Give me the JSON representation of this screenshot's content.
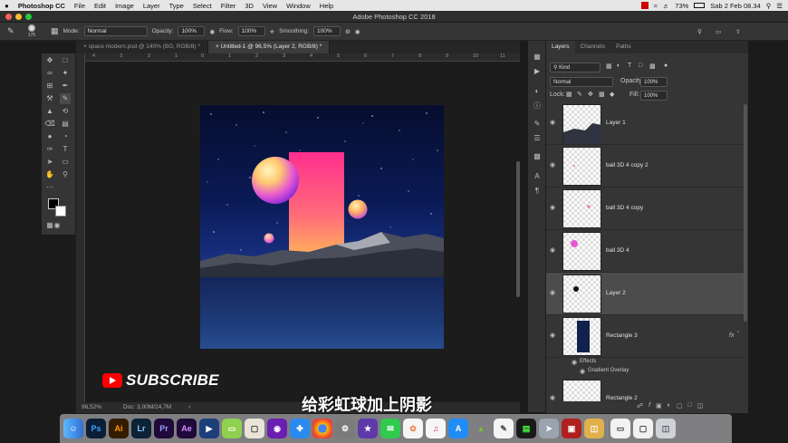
{
  "menubar": {
    "apple": "",
    "app": "Photoshop CC",
    "items": [
      "File",
      "Edit",
      "Image",
      "Layer",
      "Type",
      "Select",
      "Filter",
      "3D",
      "View",
      "Window",
      "Help"
    ],
    "battery": "73%",
    "clock": "Sab 2 Feb 08.34"
  },
  "window": {
    "title": "Adobe Photoshop CC 2018"
  },
  "options": {
    "brush_size": "175",
    "mode_label": "Mode:",
    "mode_value": "Normal",
    "opacity_label": "Opacity:",
    "opacity_value": "100%",
    "flow_label": "Flow:",
    "flow_value": "100%",
    "smoothing_label": "Smoothing:",
    "smoothing_value": "100%"
  },
  "tabs": [
    {
      "label": "space modern.psd @ 140% (BG, RGB/8) *"
    },
    {
      "label": "Untitled-1 @ 96,5% (Layer 2, RGB/8) *"
    }
  ],
  "ruler": {
    "top": [
      "4",
      "3",
      "2",
      "1",
      "0",
      "1",
      "2",
      "3",
      "4",
      "5",
      "6",
      "7",
      "8",
      "9",
      "10",
      "11"
    ]
  },
  "status": {
    "zoom": "96,52%",
    "doc": "Doc: 3,00M/24,7M"
  },
  "panel": {
    "tabs": [
      "Layers",
      "Channels",
      "Paths"
    ],
    "kind": "Kind",
    "blend": "Normal",
    "opacity_label": "Opacity:",
    "opacity_value": "100%",
    "lock_label": "Lock:",
    "fill_label": "Fill:",
    "fill_value": "100%",
    "layers": [
      {
        "name": "Layer 1"
      },
      {
        "name": "ball 3D 4 copy 2"
      },
      {
        "name": "ball 3D 4 copy"
      },
      {
        "name": "ball 3D 4"
      },
      {
        "name": "Layer 2"
      },
      {
        "name": "Rectangle 3",
        "fx": "fx"
      },
      {
        "name": "Rectangle 2"
      }
    ],
    "effects_label": "Effects",
    "gradient_overlay": "Gradient Overlay"
  },
  "overlay": {
    "subscribe": "SUBSCRIBE",
    "subtitle": "给彩虹球加上阴影"
  },
  "dock": [
    "Ps",
    "Ai",
    "Lr",
    "Pr",
    "Ae"
  ],
  "colors": {
    "ps_blue": "#31a8ff",
    "ai_orange": "#ff9a00",
    "pr_purple": "#9999ff",
    "youtube_red": "#ff0000"
  }
}
